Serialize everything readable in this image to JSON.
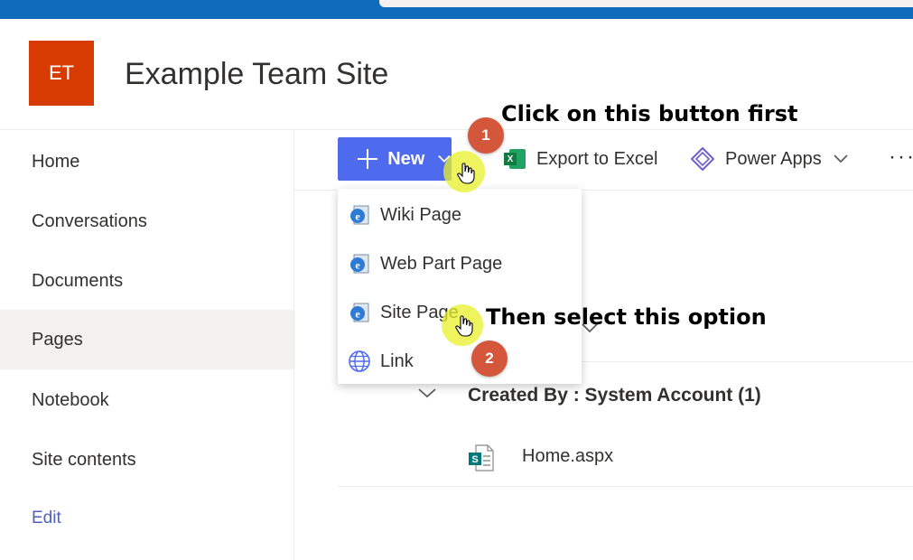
{
  "site": {
    "logo_initials": "ET",
    "title": "Example Team Site",
    "logo_color": "#d83b01"
  },
  "nav": {
    "items": [
      {
        "label": "Home",
        "active": false
      },
      {
        "label": "Conversations",
        "active": false
      },
      {
        "label": "Documents",
        "active": false
      },
      {
        "label": "Pages",
        "active": true
      },
      {
        "label": "Notebook",
        "active": false
      },
      {
        "label": "Site contents",
        "active": false
      }
    ],
    "edit_label": "Edit"
  },
  "command_bar": {
    "new_label": "New",
    "export_label": "Export to Excel",
    "power_apps_label": "Power Apps",
    "more_label": "···",
    "accent": "#4f6bed"
  },
  "new_menu": {
    "items": [
      {
        "label": "Wiki Page",
        "icon": "page-icon"
      },
      {
        "label": "Web Part Page",
        "icon": "page-icon"
      },
      {
        "label": "Site Page",
        "icon": "page-icon"
      },
      {
        "label": "Link",
        "icon": "globe-icon"
      }
    ]
  },
  "list": {
    "group_title": "Created By : System Account (1)",
    "files": [
      {
        "name": "Home.aspx",
        "icon": "sharepoint-page-icon"
      }
    ]
  },
  "annotations": {
    "step1_number": "1",
    "step1_text": "Click on this button first",
    "step2_number": "2",
    "step2_text": "Then select this option",
    "badge_color": "#d4573c"
  }
}
